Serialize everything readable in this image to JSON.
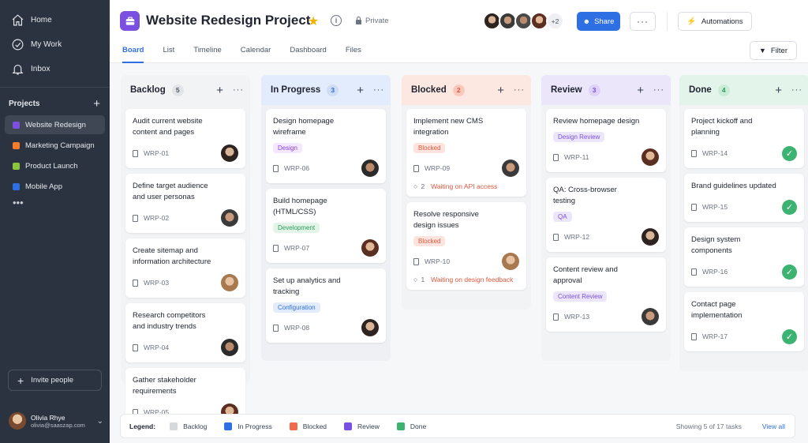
{
  "colors": {
    "accent": "#2f6fe4",
    "sidebar_bg": "#2c3340",
    "backlog": "#d6d8dc",
    "in_progress": "#2f6fe4",
    "blocked": "#f06b4a",
    "review": "#7b4fe0",
    "done": "#3cb371"
  },
  "sidebar": {
    "nav": [
      {
        "label": "Home",
        "icon": "home-icon"
      },
      {
        "label": "My Work",
        "icon": "check-circle-icon"
      },
      {
        "label": "Inbox",
        "icon": "bell-icon"
      }
    ],
    "projects_title": "Projects",
    "projects": [
      {
        "label": "Website Redesign",
        "color": "#7b4fe0",
        "active": true
      },
      {
        "label": "Marketing Campaign",
        "color": "#f57c2b",
        "active": false
      },
      {
        "label": "Product Launch",
        "color": "#8cc63f",
        "active": false
      },
      {
        "label": "Mobile App",
        "color": "#2f6fe4",
        "active": false
      }
    ],
    "more": "•••",
    "invite_label": "Invite people",
    "user": {
      "name": "Olivia Rhye",
      "email": "olivia@saaszap.com"
    }
  },
  "header": {
    "title": "Website Redesign Project",
    "privacy": "Private",
    "extra_members": "+2",
    "share_label": "Share",
    "automations_label": "Automations",
    "filter_label": "Filter",
    "tabs": [
      "Board",
      "List",
      "Timeline",
      "Calendar",
      "Dashboard",
      "Files"
    ],
    "active_tab": "Board"
  },
  "board": {
    "columns": [
      {
        "title": "Backlog",
        "count": "5",
        "cards": [
          {
            "title": "Audit current website content and pages",
            "id": "WRP-01"
          },
          {
            "title": "Define target audience and user personas",
            "id": "WRP-02"
          },
          {
            "title": "Create sitemap and information architecture",
            "id": "WRP-03"
          },
          {
            "title": "Research competitors and industry trends",
            "id": "WRP-04"
          },
          {
            "title": "Gather stakeholder requirements",
            "id": "WRP-05"
          }
        ]
      },
      {
        "title": "In Progress",
        "count": "3",
        "cards": [
          {
            "title": "Design homepage wireframe",
            "badge": "Design",
            "id": "WRP-06"
          },
          {
            "title": "Build homepage (HTML/CSS)",
            "badge": "Development",
            "id": "WRP-07"
          },
          {
            "title": "Set up analytics and tracking",
            "badge": "Configuration",
            "id": "WRP-08"
          }
        ]
      },
      {
        "title": "Blocked",
        "count": "2",
        "cards": [
          {
            "title": "Implement new CMS integration",
            "badge": "Blocked",
            "id": "WRP-09",
            "comments": "2",
            "warning": "Waiting on API access"
          },
          {
            "title": "Resolve responsive design issues",
            "badge": "Blocked",
            "id": "WRP-10",
            "comments": "1",
            "warning": "Waiting on design feedback"
          }
        ]
      },
      {
        "title": "Review",
        "count": "3",
        "cards": [
          {
            "title": "Review homepage design",
            "badge": "Design Review",
            "id": "WRP-11"
          },
          {
            "title": "QA: Cross-browser testing",
            "badge": "QA",
            "id": "WRP-12"
          },
          {
            "title": "Content review and approval",
            "badge": "Content Review",
            "id": "WRP-13"
          }
        ]
      },
      {
        "title": "Done",
        "count": "4",
        "cards": [
          {
            "title": "Project kickoff and planning",
            "id": "WRP-14"
          },
          {
            "title": "Brand guidelines updated",
            "id": "WRP-15"
          },
          {
            "title": "Design system components",
            "id": "WRP-16"
          },
          {
            "title": "Contact page implementation",
            "id": "WRP-17"
          }
        ]
      }
    ]
  },
  "legend": {
    "label": "Legend:",
    "items": [
      "Backlog",
      "In Progress",
      "Blocked",
      "Review",
      "Done"
    ],
    "showing": "Showing 5 of 17 tasks",
    "view_all": "View all"
  }
}
